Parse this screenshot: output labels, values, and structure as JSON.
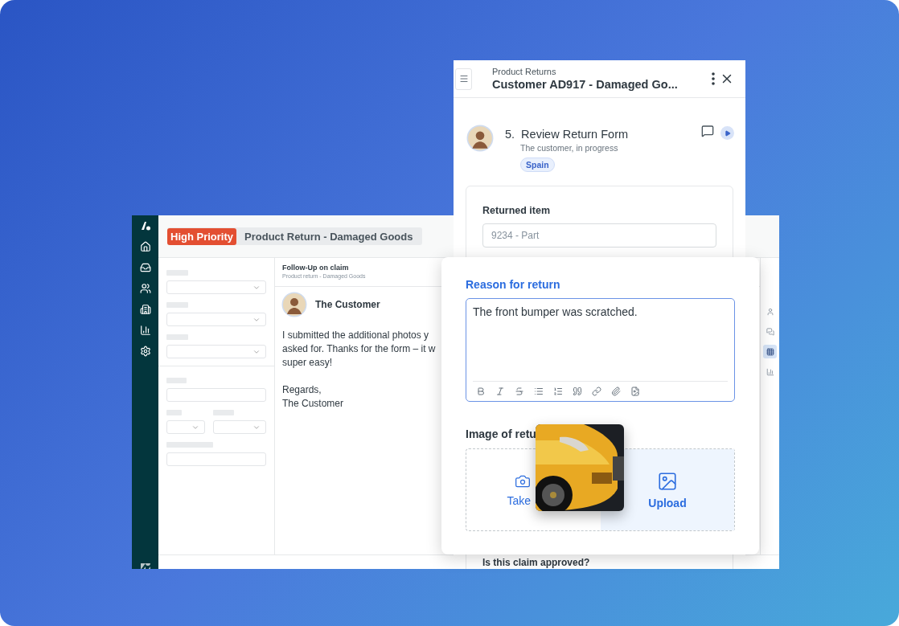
{
  "workspace": {
    "tags": [
      {
        "kind": "priority",
        "label": "High Priority"
      },
      {
        "kind": "title",
        "label": "Product Return - Damaged Goods"
      }
    ],
    "conversation": {
      "title": "Follow-Up on claim",
      "subtitle": "Product return - Damaged Goods",
      "author": "The Customer",
      "paragraphs": [
        [
          "I submitted the additional photos y",
          "asked for. Thanks for the form – it w",
          "super easy!"
        ],
        [
          "Regards,",
          "The Customer"
        ]
      ]
    },
    "rail": [
      {
        "selected": false
      },
      {
        "selected": false
      },
      {
        "selected": true
      },
      {
        "selected": false
      }
    ]
  },
  "side_panel": {
    "overline": "Product Returns",
    "title": "Customer AD917 - Damaged Go...",
    "step": {
      "number": "5.",
      "title": "Review Return Form",
      "subtitle": "The customer, in progress",
      "tag": "Spain"
    },
    "form": {
      "label": "Returned item",
      "placeholder": "9234 - Part",
      "next_label": "Is this claim approved?"
    }
  },
  "return_card": {
    "label": "Reason for return",
    "value": "The front bumper was scratched.",
    "image_label": "Image of retu",
    "options": [
      {
        "kind": "camera",
        "label": "Take",
        "selected": false
      },
      {
        "kind": "upload",
        "label": "Upload",
        "selected": true
      }
    ]
  }
}
